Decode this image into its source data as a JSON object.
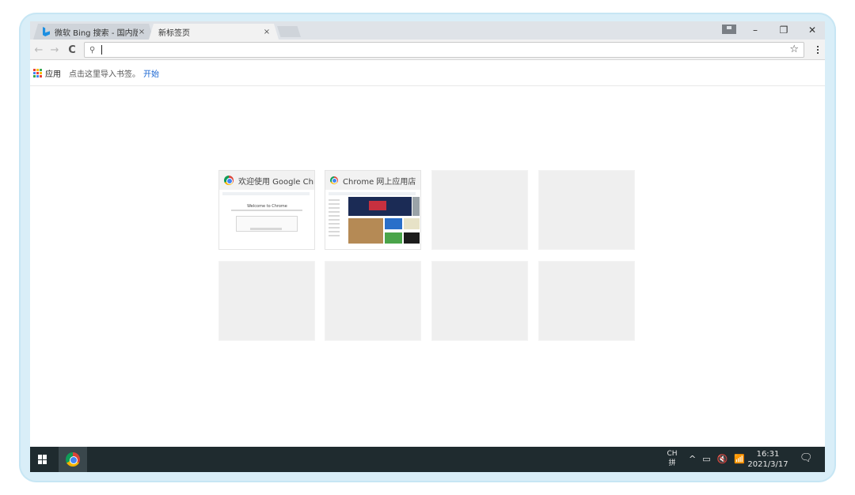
{
  "tabs": [
    {
      "title": "微软 Bing 搜索 - 国内版",
      "close": "×"
    },
    {
      "title": "新标签页",
      "close": "×"
    }
  ],
  "window_controls": {
    "minimize": "–",
    "restore": "❐",
    "close": "✕"
  },
  "toolbar": {
    "back": "←",
    "forward": "→",
    "reload": "C",
    "search_glyph": "⚲",
    "star": "☆"
  },
  "omnibox": {
    "value": "",
    "placeholder": ""
  },
  "bookmarks_bar": {
    "apps_label": "应用",
    "hint": "点击这里导入书签。",
    "link": "开始"
  },
  "most_visited": [
    {
      "title": "欢迎使用 Google Chr",
      "screenshot_text": "Welcome to Chrome"
    },
    {
      "title": "Chrome 网上应用店"
    }
  ],
  "taskbar": {
    "ime_top": "CH",
    "ime_bottom": "拼",
    "tray_icons": [
      "^",
      "▭",
      "🔇",
      "📶"
    ],
    "time": "16:31",
    "date": "2021/3/17",
    "notif_glyph": "🗨"
  },
  "colors": {
    "apps_grid": [
      "#e94235",
      "#fbbc04",
      "#34a853",
      "#4285f4",
      "#e94235",
      "#fbbc04",
      "#34a853",
      "#4285f4",
      "#e94235"
    ]
  }
}
